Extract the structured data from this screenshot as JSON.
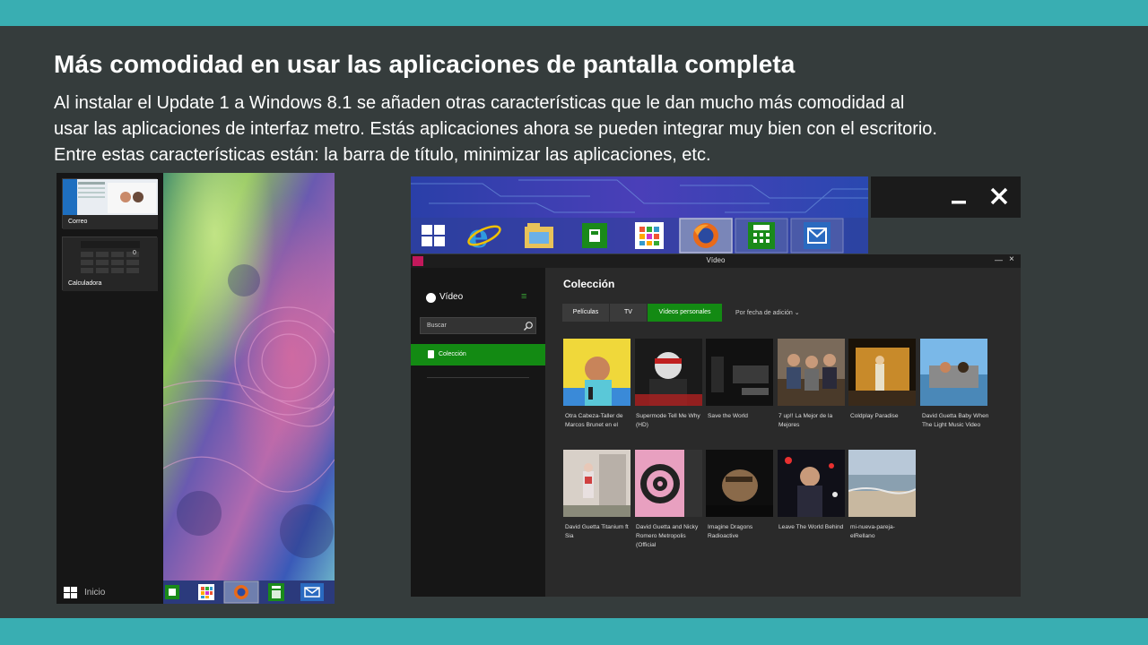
{
  "slide": {
    "title": "Más comodidad en usar las aplicaciones de pantalla completa",
    "body_lines": [
      "Al instalar el Update 1 a Windows 8.1 se añaden otras características que le dan mucho más comodidad al",
      "usar las aplicaciones de interfaz metro. Estás aplicaciones ahora se pueden integrar muy bien con el escritorio.",
      "Entre estas características están: la barra de título, minimizar las aplicaciones, etc."
    ],
    "colors": {
      "background": "#353c3c",
      "band": "#39aeb2",
      "accent": "#138a13"
    }
  },
  "left_screenshot": {
    "switcher": [
      {
        "label": "Correo",
        "icon": "mail-app-thumbnail"
      },
      {
        "label": "Calculadora",
        "icon": "calculator-app-thumbnail",
        "display": "0"
      }
    ],
    "start_label": "Inicio",
    "taskbar_icons": [
      "store-icon",
      "apps-grid-icon",
      "firefox-icon",
      "calculator-icon",
      "mail-icon"
    ]
  },
  "taskbar_snippet": {
    "icons": [
      "windows-start-icon",
      "internet-explorer-icon",
      "file-explorer-icon",
      "store-icon",
      "apps-grid-icon",
      "firefox-icon",
      "calculator-icon",
      "mail-icon"
    ],
    "caption_buttons": [
      "minimize-icon",
      "close-icon"
    ]
  },
  "video_app": {
    "window_title": "Vídeo",
    "app_name": "Vídeo",
    "search_placeholder": "Buscar",
    "nav_item": "Colección",
    "heading": "Colección",
    "tabs": [
      "Películas",
      "TV",
      "Vídeos personales"
    ],
    "active_tab": "Vídeos personales",
    "sort_label": "Por fecha de adición ⌄",
    "videos": [
      {
        "title": "Otra Cabeza-Taller de Marcos Brunet en el"
      },
      {
        "title": "Supermode Tell Me Why (HD)"
      },
      {
        "title": "Save the World"
      },
      {
        "title": "7 up!! La Mejor de la Mejores"
      },
      {
        "title": "Coldplay Paradise"
      },
      {
        "title": "David Guetta Baby When The Light Music Video"
      },
      {
        "title": "David Guetta Titanium ft Sia"
      },
      {
        "title": "David Guetta and Nicky Romero Metropolis (Official"
      },
      {
        "title": "Imagine Dragons Radioactive"
      },
      {
        "title": "Leave The World Behind"
      },
      {
        "title": "mi-nueva-pareja-elRellano"
      }
    ]
  }
}
